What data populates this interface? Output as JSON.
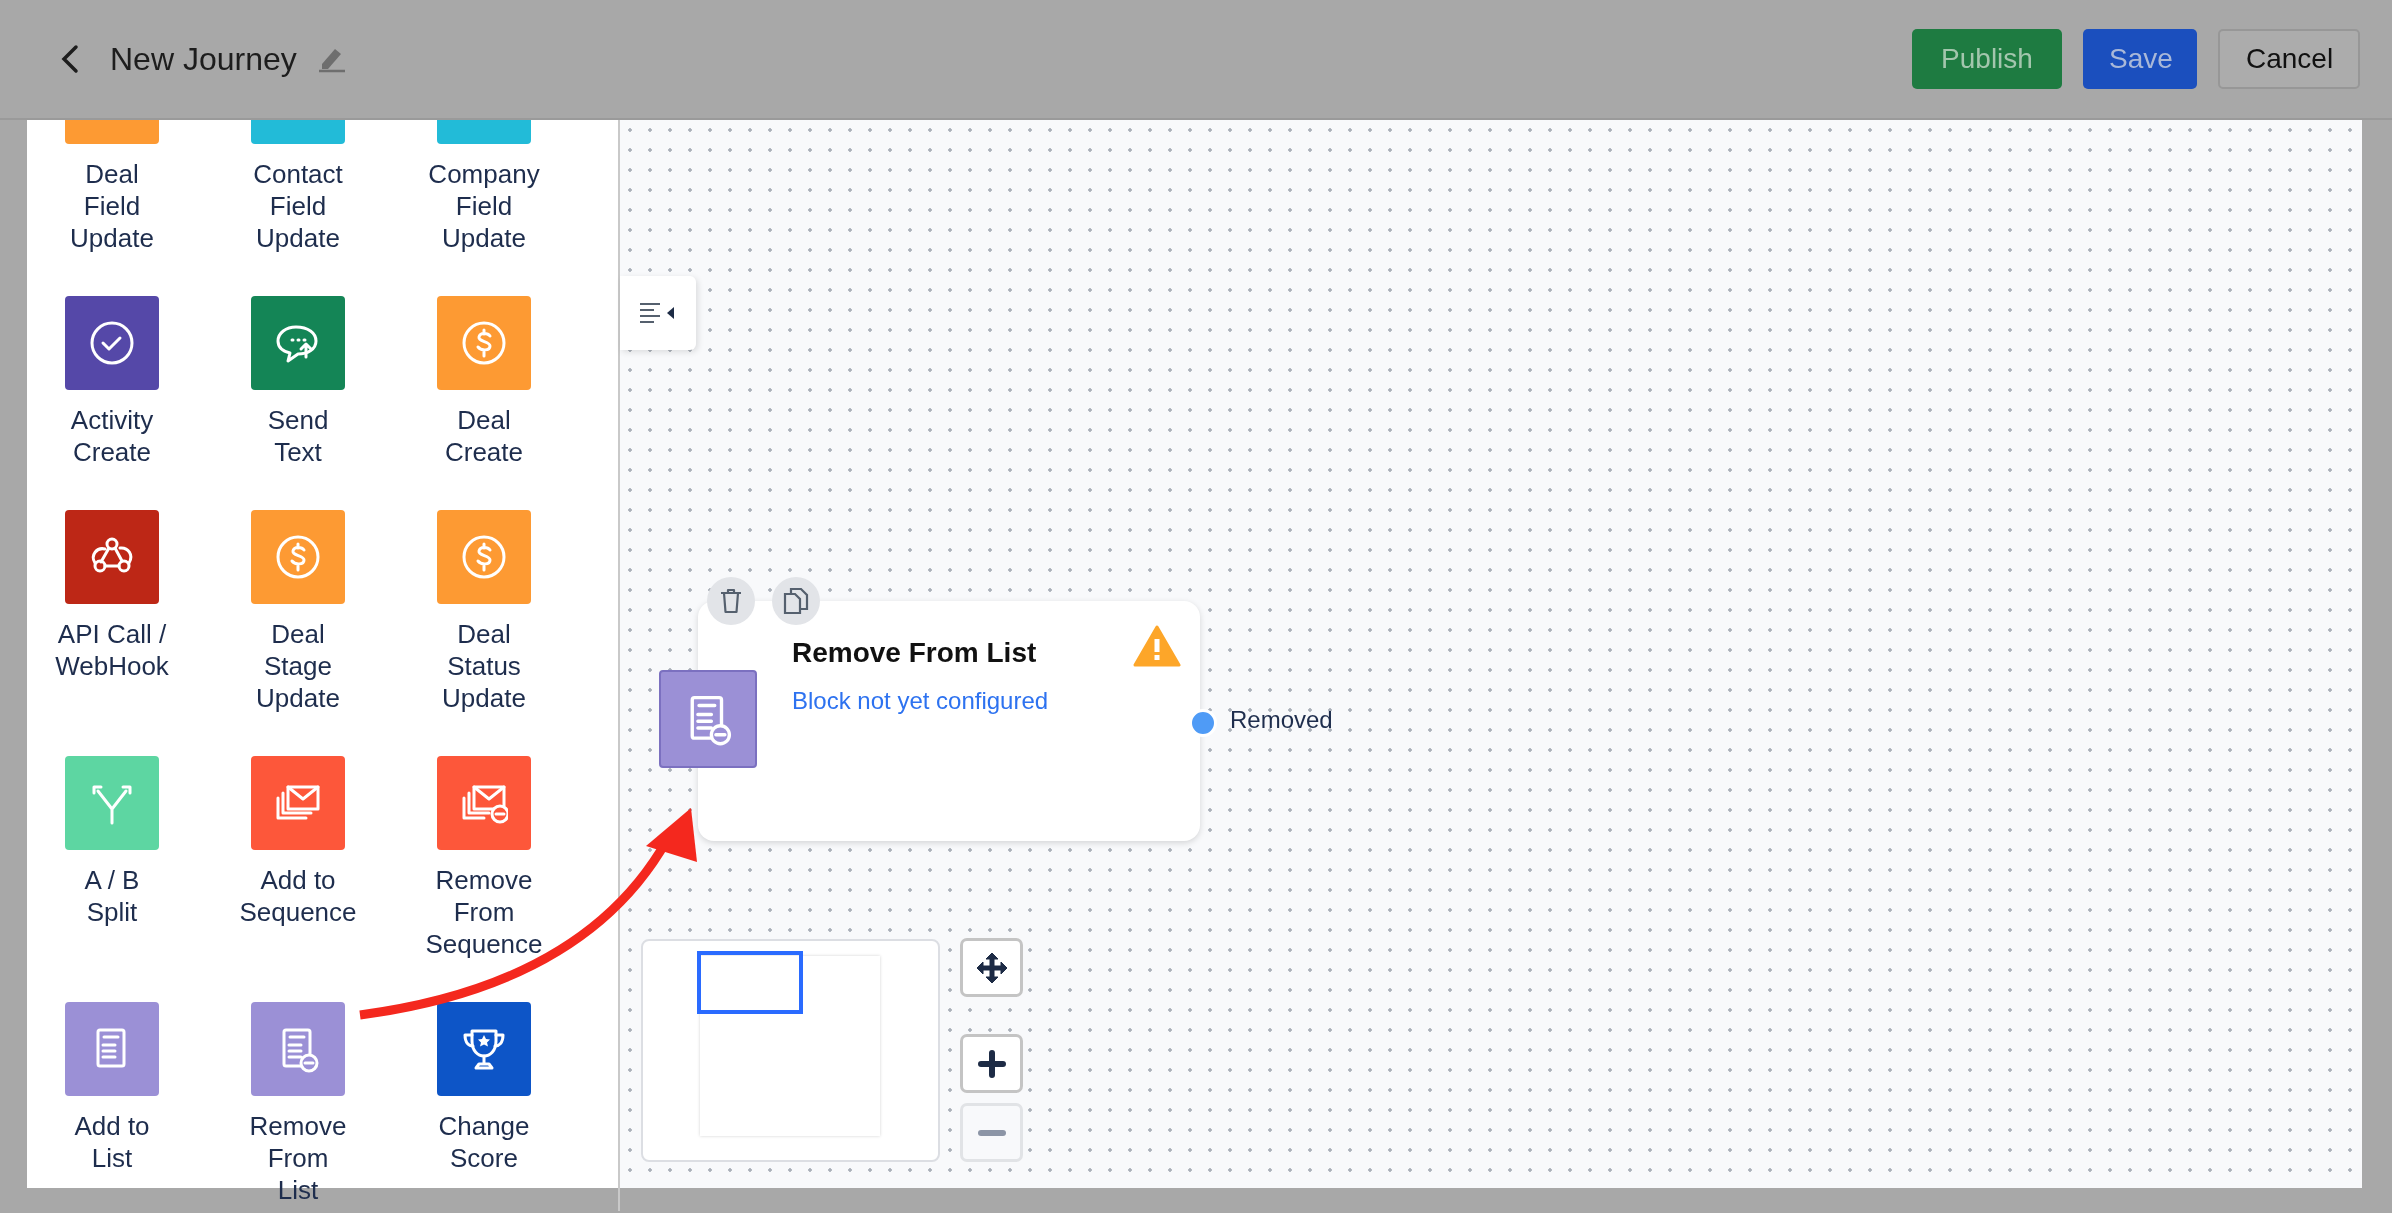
{
  "header": {
    "title": "New Journey",
    "buttons": [
      {
        "label": "Publish",
        "kind": "publish"
      },
      {
        "label": "Save",
        "kind": "save"
      },
      {
        "label": "Cancel",
        "kind": "cancel"
      }
    ]
  },
  "palette": {
    "items": [
      {
        "label": "Deal\nField\nUpdate",
        "color": "#fd9a33",
        "kind": "field"
      },
      {
        "label": "Contact\nField\nUpdate",
        "color": "#22bbd8",
        "kind": "field"
      },
      {
        "label": "Company\nField\nUpdate",
        "color": "#22bbd8",
        "kind": "field"
      },
      {
        "label": "Activity\nCreate",
        "color": "#5548a8",
        "kind": "activity"
      },
      {
        "label": "Send\nText",
        "color": "#148556",
        "kind": "text"
      },
      {
        "label": "Deal\nCreate",
        "color": "#fd9a33",
        "kind": "deal"
      },
      {
        "label": "API Call /\nWebHook",
        "color": "#bd2716",
        "kind": "webhook"
      },
      {
        "label": "Deal\nStage\nUpdate",
        "color": "#fd9a33",
        "kind": "deal"
      },
      {
        "label": "Deal\nStatus\nUpdate",
        "color": "#fd9a33",
        "kind": "deal"
      },
      {
        "label": "A / B\nSplit",
        "color": "#5dd6a2",
        "kind": "split"
      },
      {
        "label": "Add to\nSequence",
        "color": "#fd573a",
        "kind": "sequence"
      },
      {
        "label": "Remove\nFrom\nSequence",
        "color": "#fd573a",
        "kind": "sequence-remove"
      },
      {
        "label": "Add to\nList",
        "color": "#9b90d6",
        "kind": "list"
      },
      {
        "label": "Remove\nFrom\nList",
        "color": "#9b90d6",
        "kind": "list-remove"
      },
      {
        "label": "Change\nScore",
        "color": "#0d55c7",
        "kind": "score"
      }
    ]
  },
  "canvas": {
    "node": {
      "title": "Remove From List",
      "status": "Block not yet configured",
      "kind": "list-remove",
      "color": "#9b90d6",
      "warning": true,
      "output": "Removed"
    },
    "zoom_controls": [
      {
        "kind": "move",
        "disabled": false
      },
      {
        "kind": "zoom-in",
        "disabled": false
      },
      {
        "kind": "zoom-out",
        "disabled": true
      }
    ]
  }
}
